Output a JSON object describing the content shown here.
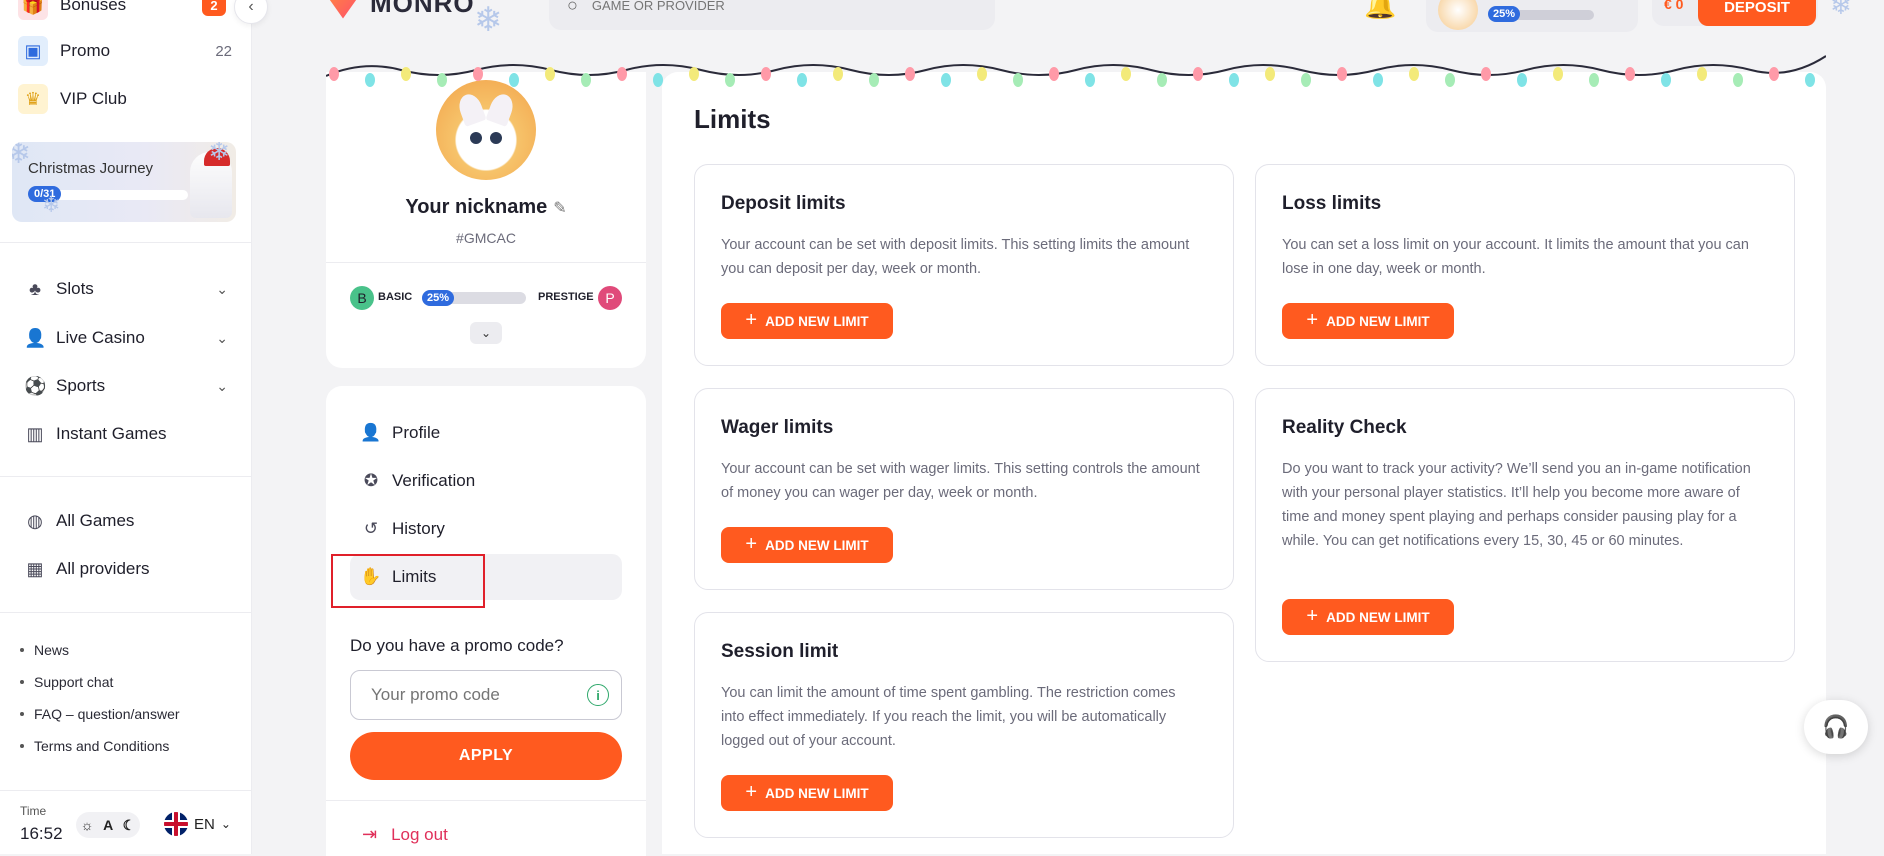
{
  "sidebar": {
    "top_items": [
      {
        "label": "Bonuses",
        "badge": "2",
        "icon": "gift-icon"
      },
      {
        "label": "Promo",
        "count": "22",
        "icon": "promo-icon"
      },
      {
        "label": "VIP Club",
        "icon": "crown-icon"
      }
    ],
    "journey": {
      "title": "Christmas Journey",
      "progress_label": "0/31",
      "progress": 0.0
    },
    "nav": [
      {
        "label": "Slots",
        "icon": "slots-icon"
      },
      {
        "label": "Live Casino",
        "icon": "live-casino-icon"
      },
      {
        "label": "Sports",
        "icon": "sports-icon"
      },
      {
        "label": "Instant Games",
        "icon": "instant-games-icon"
      }
    ],
    "nav2": [
      {
        "label": "All Games",
        "icon": "all-games-icon"
      },
      {
        "label": "All providers",
        "icon": "providers-icon"
      }
    ],
    "footer_links": [
      "News",
      "Support chat",
      "FAQ – question/answer",
      "Terms and Conditions"
    ],
    "time_label": "Time",
    "time_value": "16:52",
    "theme_label": "A",
    "language": "EN"
  },
  "header": {
    "brand": "MONRO",
    "search_placeholder": "GAME OR PROVIDER",
    "level_progress": "25%",
    "balance": "€ 0",
    "deposit_label": "DEPOSIT"
  },
  "profile": {
    "nickname": "Your nickname",
    "user_id": "#GMCAC",
    "level_from_letter": "B",
    "level_from": "BASIC",
    "level_progress": "25%",
    "level_to": "PRESTIGE",
    "level_to_letter": "P"
  },
  "menu": {
    "items": [
      {
        "label": "Profile",
        "icon": "user-icon"
      },
      {
        "label": "Verification",
        "icon": "verification-icon"
      },
      {
        "label": "History",
        "icon": "history-icon"
      },
      {
        "label": "Limits",
        "icon": "hand-icon"
      }
    ],
    "active": "Limits",
    "promo_question": "Do you have a promo code?",
    "promo_placeholder": "Your promo code",
    "apply_label": "APPLY",
    "logout_label": "Log out"
  },
  "limits": {
    "title": "Limits",
    "cards": [
      {
        "title": "Deposit limits",
        "text": "Your account can be set with deposit limits. This setting limits the amount you can deposit per day, week or month.",
        "button": "ADD NEW LIMIT"
      },
      {
        "title": "Loss limits",
        "text": "You can set a loss limit on your account. It limits the amount that you can lose in one day, week or month.",
        "button": "ADD NEW LIMIT"
      },
      {
        "title": "Wager limits",
        "text": "Your account can be set with wager limits. This setting controls the amount of money you can wager per day, week or month.",
        "button": "ADD NEW LIMIT"
      },
      {
        "title": "Reality Check",
        "text": "Do you want to track your activity? We’ll send you an in-game notification with your personal player statistics. It’ll help you become more aware of time and money spent playing and perhaps consider pausing play for a while. You can get notifications every 15, 30, 45 or 60 minutes.",
        "button": "ADD NEW LIMIT"
      },
      {
        "title": "Session limit",
        "text": "You can limit the amount of time spent gambling. The restriction comes into effect immediately. If you reach the limit, you will be automatically logged out of your account.",
        "button": "ADD NEW LIMIT"
      }
    ]
  },
  "colors": {
    "accent": "#ff5a1f",
    "progress": "#2f6bde",
    "highlight": "#e0202a",
    "logout": "#e0305a"
  }
}
